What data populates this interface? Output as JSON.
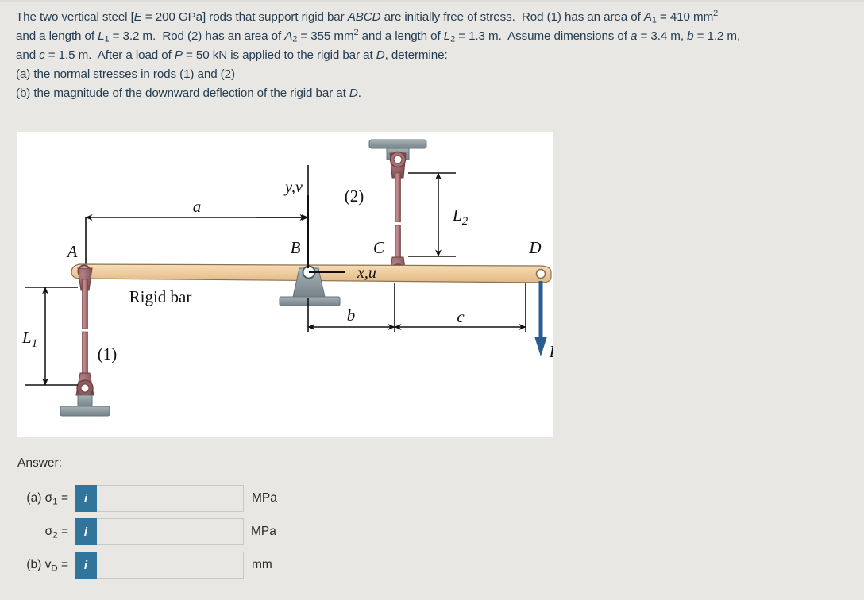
{
  "problem": {
    "lines": [
      "The two vertical steel [E = 200 GPa] rods that support rigid bar ABCD are initially free of stress.  Rod (1) has an area of A1 = 410 mm2",
      "and a length of L1 = 3.2 m.  Rod (2) has an area of A2 = 355 mm2 and a length of L2 = 1.3 m.  Assume dimensions of a = 3.4 m, b = 1.2 m,",
      "and c = 1.5 m.  After a load of P = 50 kN is applied to the rigid bar at D, determine:",
      "(a) the normal stresses in rods (1) and (2)",
      "(b) the magnitude of the downward deflection of the rigid bar at D."
    ],
    "given": {
      "E": "200 GPa",
      "bar_name": "ABCD",
      "A1": "410 mm2",
      "L1": "3.2 m",
      "A2": "355 mm2",
      "L2": "1.3 m",
      "a": "3.4 m",
      "b": "1.2 m",
      "c": "1.5 m",
      "P": "50 kN",
      "load_point": "D"
    }
  },
  "figure": {
    "caption_rigid_bar": "Rigid bar",
    "joint_labels": {
      "A": "A",
      "B": "B",
      "C": "C",
      "D": "D"
    },
    "rod_labels": {
      "rod1": "(1)",
      "rod2": "(2)"
    },
    "dimension_labels": {
      "a": "a",
      "b": "b",
      "c": "c",
      "L1": "L1",
      "L2": "L2"
    },
    "axis_labels": {
      "horizontal": "x,u",
      "vertical": "y,v"
    },
    "load_label": "P",
    "colors": {
      "bar_fill": "#f0cfa0",
      "bar_edge": "#8a7352",
      "rod": "#b07a7d",
      "rod_edge": "#7a4b4e",
      "support_gray": "#8e9aa0",
      "support_edge": "#65737a",
      "load_arrow": "#2a5c8f",
      "panel_bg": "#ffffff"
    }
  },
  "answer": {
    "heading": "Answer:",
    "rows": [
      {
        "name": "sigma1",
        "label_a": "(a) σ1 =",
        "info": "i",
        "value": "",
        "unit": "MPa"
      },
      {
        "name": "sigma2",
        "label_a": "σ2 =",
        "info": "i",
        "value": "",
        "unit": "MPa"
      },
      {
        "name": "vD",
        "label_a": "(b) v_D =",
        "info": "i",
        "value": "",
        "unit": "mm"
      }
    ]
  }
}
